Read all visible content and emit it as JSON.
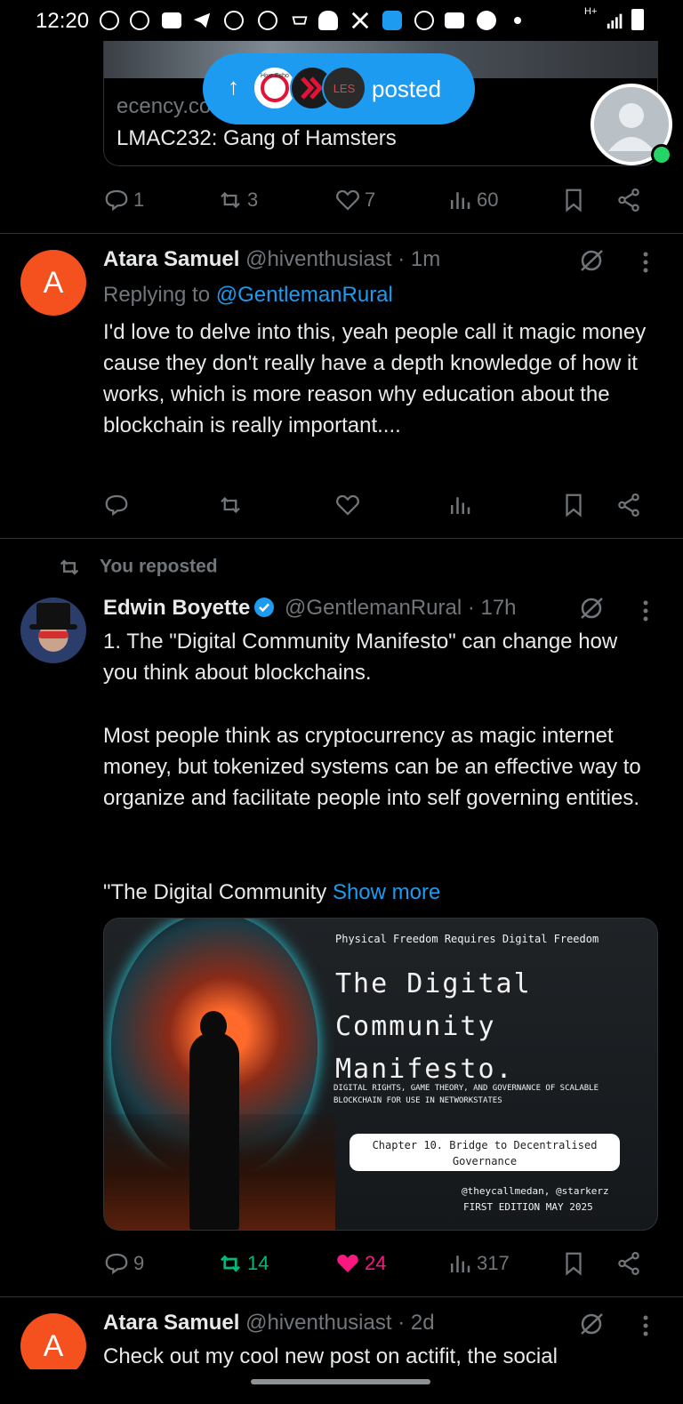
{
  "status_bar": {
    "time": "12:20",
    "network": "H+",
    "icons": [
      "whatsapp-icon",
      "whatsapp-icon",
      "chat-icon",
      "telegram-icon",
      "chrome-icon",
      "chrome-icon",
      "hat-icon",
      "burger-icon",
      "x-icon",
      "s-icon",
      "chrome-icon",
      "folder-icon",
      "b-icon",
      "dot-icon",
      "signal-icon",
      "battery-icon"
    ]
  },
  "top_card": {
    "domain": "ecency.co",
    "title": "LMAC232: Gang of Hamsters",
    "actions": {
      "replies": "1",
      "reposts": "3",
      "likes": "7",
      "views": "60"
    }
  },
  "posted_pill": {
    "label": "posted",
    "avatar_labels": [
      "Hive Echo",
      "",
      "LES"
    ]
  },
  "posts": [
    {
      "avatar_letter": "A",
      "author": "Atara Samuel",
      "handle": "@hiventhusiast",
      "time": "· 1m",
      "replying_prefix": "Replying to ",
      "replying_to": "@GentlemanRural",
      "text": "I'd  love to delve into this, yeah people call  it magic money cause they don't  really  have a depth knowledge  of how it works,  which is more reason why education about the blockchain is really important....",
      "actions": {
        "replies": "",
        "reposts": "",
        "likes": "",
        "views": ""
      }
    },
    {
      "repost_label": "You reposted",
      "author": "Edwin Boyette",
      "handle": "@GentlemanRural",
      "time": "· 17h",
      "text_p1": "1. The \"Digital Community Manifesto\" can change how you think about blockchains.",
      "text_p2": "Most people think as cryptocurrency as magic internet money, but tokenized systems can be an effective way to organize and facilitate people into self governing entities.",
      "text_p3": "\"The Digital Community ",
      "show_more": "Show more",
      "image": {
        "tagline": "Physical Freedom Requires Digital Freedom",
        "title_l1": "The Digital",
        "title_l2": "Community",
        "title_l3": "Manifesto.",
        "subtitle": "DIGITAL RIGHTS, GAME THEORY, AND GOVERNANCE OF SCALABLE BLOCKCHAIN FOR USE IN NETWORKSTATES",
        "chapter": "Chapter 10. Bridge to Decentralised Governance",
        "authors": "@theycallmedan, @starkerz",
        "edition": "FIRST EDITION MAY 2025"
      },
      "actions": {
        "replies": "9",
        "reposts": "14",
        "likes": "24",
        "views": "317"
      },
      "colors": {
        "reposted": "#00ba7c",
        "liked": "#f91880"
      }
    },
    {
      "avatar_letter": "A",
      "author": "Atara Samuel",
      "handle": "@hiventhusiast",
      "time": "· 2d",
      "text": "Check out my cool new post on actifit, the social"
    }
  ],
  "colors": {
    "accent": "#1d9bf0",
    "muted": "#71767b",
    "divider": "#2f3336",
    "avatar_orange": "#f4511e"
  }
}
